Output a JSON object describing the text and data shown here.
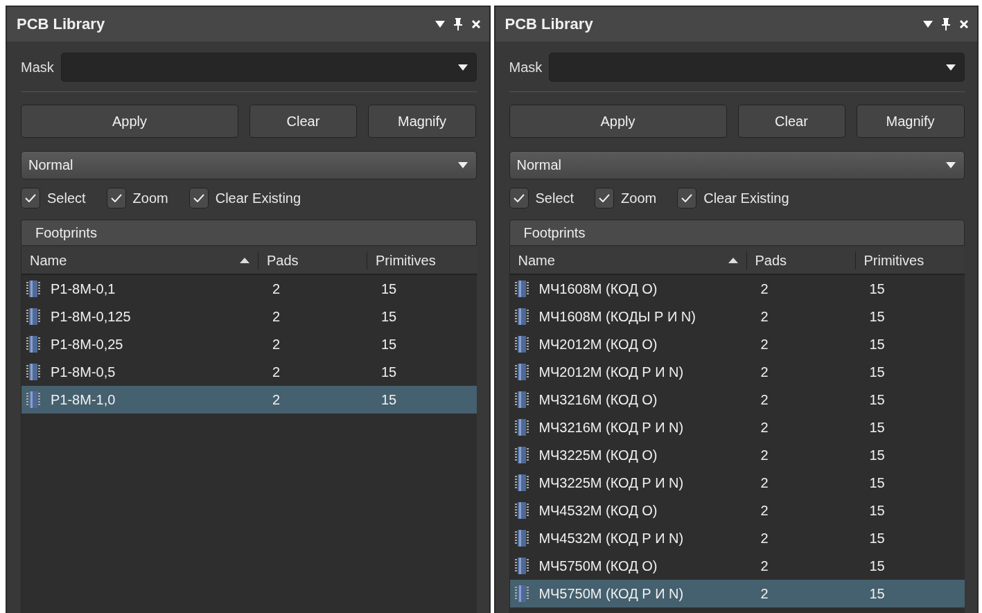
{
  "panels": [
    {
      "title": "PCB Library",
      "mask": {
        "label": "Mask"
      },
      "buttons": [
        "Apply",
        "Clear",
        "Magnify"
      ],
      "mode": {
        "value": "Normal"
      },
      "options": [
        {
          "label": "Select",
          "checked": true
        },
        {
          "label": "Zoom",
          "checked": true
        },
        {
          "label": "Clear Existing",
          "checked": true
        }
      ],
      "section_title": "Footprints",
      "columns": [
        {
          "label": "Name",
          "sorted": true
        },
        {
          "label": "Pads",
          "sorted": false
        },
        {
          "label": "Primitives",
          "sorted": false
        }
      ],
      "rows": [
        {
          "name": "P1-8M-0,1",
          "pads": "2",
          "primitives": "15",
          "selected": false
        },
        {
          "name": "P1-8M-0,125",
          "pads": "2",
          "primitives": "15",
          "selected": false
        },
        {
          "name": "P1-8M-0,25",
          "pads": "2",
          "primitives": "15",
          "selected": false
        },
        {
          "name": "P1-8M-0,5",
          "pads": "2",
          "primitives": "15",
          "selected": false
        },
        {
          "name": "P1-8M-1,0",
          "pads": "2",
          "primitives": "15",
          "selected": true
        }
      ]
    },
    {
      "title": "PCB Library",
      "mask": {
        "label": "Mask"
      },
      "buttons": [
        "Apply",
        "Clear",
        "Magnify"
      ],
      "mode": {
        "value": "Normal"
      },
      "options": [
        {
          "label": "Select",
          "checked": true
        },
        {
          "label": "Zoom",
          "checked": true
        },
        {
          "label": "Clear Existing",
          "checked": true
        }
      ],
      "section_title": "Footprints",
      "columns": [
        {
          "label": "Name",
          "sorted": true
        },
        {
          "label": "Pads",
          "sorted": false
        },
        {
          "label": "Primitives",
          "sorted": false
        }
      ],
      "rows": [
        {
          "name": "МЧ1608М (КОД О)",
          "pads": "2",
          "primitives": "15",
          "selected": false
        },
        {
          "name": "МЧ1608М (КОДЫ Р И N)",
          "pads": "2",
          "primitives": "15",
          "selected": false
        },
        {
          "name": "МЧ2012М (КОД О)",
          "pads": "2",
          "primitives": "15",
          "selected": false
        },
        {
          "name": "МЧ2012М (КОД Р И N)",
          "pads": "2",
          "primitives": "15",
          "selected": false
        },
        {
          "name": "МЧ3216М (КОД О)",
          "pads": "2",
          "primitives": "15",
          "selected": false
        },
        {
          "name": "МЧ3216М (КОД Р И N)",
          "pads": "2",
          "primitives": "15",
          "selected": false
        },
        {
          "name": "МЧ3225М (КОД О)",
          "pads": "2",
          "primitives": "15",
          "selected": false
        },
        {
          "name": "МЧ3225М (КОД Р И N)",
          "pads": "2",
          "primitives": "15",
          "selected": false
        },
        {
          "name": "МЧ4532М (КОД О)",
          "pads": "2",
          "primitives": "15",
          "selected": false
        },
        {
          "name": "МЧ4532М (КОД Р И N)",
          "pads": "2",
          "primitives": "15",
          "selected": false
        },
        {
          "name": "МЧ5750М (КОД О)",
          "pads": "2",
          "primitives": "15",
          "selected": false
        },
        {
          "name": "МЧ5750М (КОД Р И N)",
          "pads": "2",
          "primitives": "15",
          "selected": true
        }
      ]
    }
  ]
}
